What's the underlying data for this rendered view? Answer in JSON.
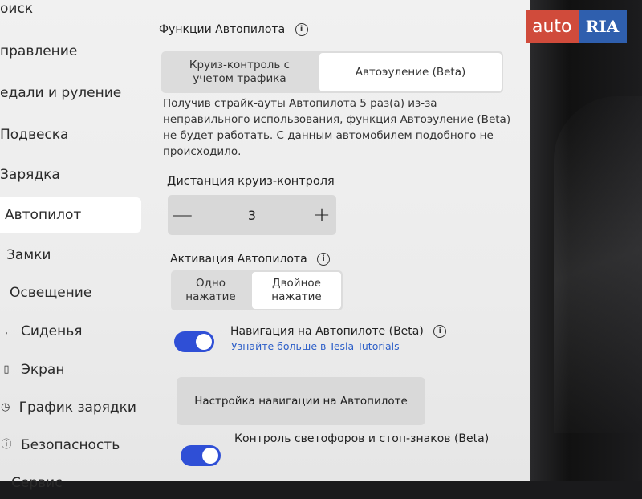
{
  "sidebar": {
    "items": [
      {
        "label": "оиск",
        "icon": ""
      },
      {
        "label": "правление",
        "icon": ""
      },
      {
        "label": "едали и руление",
        "icon": ""
      },
      {
        "label": "Подвеска",
        "icon": ""
      },
      {
        "label": "Зарядка",
        "icon": ""
      },
      {
        "label": "Автопилот",
        "icon": "",
        "active": true
      },
      {
        "label": "Замки",
        "icon": ""
      },
      {
        "label": "Освещение",
        "icon": ""
      },
      {
        "label": "Сиденья",
        "icon": "seat-icon"
      },
      {
        "label": "Экран",
        "icon": "screen-icon"
      },
      {
        "label": "График зарядки",
        "icon": "clock-icon"
      },
      {
        "label": "Безопасность",
        "icon": "shield-icon"
      },
      {
        "label": "Сервис",
        "icon": "wrench-icon"
      }
    ]
  },
  "autopilot": {
    "features_title": "Функции Автопилота",
    "mode_options": [
      "Круиз-контроль с учетом трафика",
      "Автоэуление (Beta)"
    ],
    "mode_selected_index": 1,
    "strike_notice": "Получив страйк-ауты Автопилота 5 раз(а) из-за неправильного использования, функция Автоэуление (Beta) не будет работать. С данным автомобилем подобного не происходило.",
    "cruise_distance_title": "Дистанция круиз-контроля",
    "cruise_distance_value": "3",
    "minus_label": "—",
    "plus_label": "+",
    "activation_title": "Активация Автопилота",
    "activation_options": [
      "Одно нажатие",
      "Двойное нажатие"
    ],
    "activation_selected_index": 1,
    "nav_on_autopilot_label": "Навигация на Автопилоте (Beta)",
    "nav_on_autopilot_enabled": true,
    "tutorials_link": "Узнайте больше в Tesla Tutorials",
    "nav_settings_button": "Настройка навигации на Автопилоте",
    "traffic_control_label": "Контроль светофоров и стоп-знаков (Beta)",
    "traffic_control_enabled": true
  },
  "watermark": {
    "left": "auto",
    "right": "RIA"
  },
  "colors": {
    "toggle_on": "#2f4fd6",
    "link": "#2d5fc8",
    "watermark_red": "#d04b3b",
    "watermark_blue": "#2f5fae"
  }
}
